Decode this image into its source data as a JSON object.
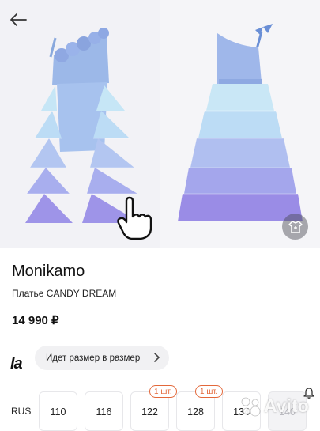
{
  "product": {
    "brand": "Monikamo",
    "subtitle": "Платье CANDY DREAM",
    "price": "14 990 ₽"
  },
  "store_logo": "la",
  "size_hint": "Идет размер в размер",
  "sizes": {
    "region": "RUS",
    "items": [
      {
        "label": "110",
        "badge": "",
        "available": true
      },
      {
        "label": "116",
        "badge": "",
        "available": true
      },
      {
        "label": "122",
        "badge": "1 шт.",
        "available": true
      },
      {
        "label": "128",
        "badge": "1 шт.",
        "available": true
      },
      {
        "label": "134",
        "badge": "",
        "available": true
      },
      {
        "label": "140",
        "badge": "",
        "available": false
      }
    ]
  },
  "watermark": "Avito",
  "colors": {
    "dress_top": "#9cb8e8",
    "dress_tulle_light": "#bfe0f4",
    "dress_tulle_mid": "#a9b5ee",
    "dress_tulle_dark": "#9a8be6",
    "badge": "#e3683a"
  },
  "icons": [
    "back-arrow-icon",
    "swipe-hand-icon",
    "wardrobe-fit-icon",
    "chevron-right-icon",
    "bell-icon"
  ]
}
